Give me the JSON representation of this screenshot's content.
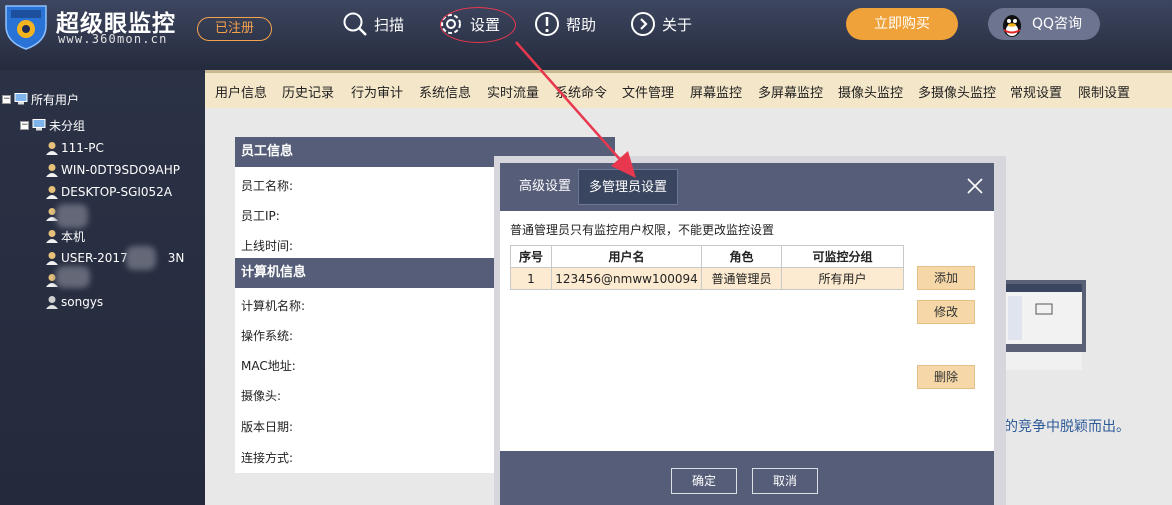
{
  "app": {
    "title": "超级眼监控",
    "url": "www.360mon.cn",
    "registered_label": "已注册"
  },
  "nav": {
    "scan": "扫描",
    "settings": "设置",
    "help": "帮助",
    "about": "关于"
  },
  "top_buttons": {
    "buy": "立即购买",
    "qq": "QQ咨询"
  },
  "tree": {
    "root": "所有用户",
    "group": "未分组",
    "computers": [
      "111-PC",
      "WIN-0DT9SDO9AHP",
      "DESKTOP-SGI052A",
      "",
      "本机",
      "USER-2017",
      "",
      "songys"
    ],
    "computer_suffix": "3N"
  },
  "tabs": [
    "用户信息",
    "历史记录",
    "行为审计",
    "系统信息",
    "实时流量",
    "系统命令",
    "文件管理",
    "屏幕监控",
    "多屏幕监控",
    "摄像头监控",
    "多摄像头监控",
    "常规设置",
    "限制设置"
  ],
  "info_panel": {
    "employee_header": "员工信息",
    "employee_fields": [
      "员工名称:",
      "员工IP:",
      "上线时间:"
    ],
    "computer_header": "计算机信息",
    "computer_fields": [
      "计算机名称:",
      "操作系统:",
      "MAC地址:",
      "摄像头:",
      "版本日期:",
      "连接方式:"
    ]
  },
  "ad_text": "烈的竞争中脱颖而出。",
  "dialog": {
    "tabs": {
      "advanced": "高级设置",
      "multi_admin": "多管理员设置"
    },
    "note": "普通管理员只有监控用户权限，不能更改监控设置",
    "table": {
      "headers": [
        "序号",
        "用户名",
        "角色",
        "可监控分组"
      ],
      "rows": [
        [
          "1",
          "123456@nmww100094",
          "普通管理员",
          "所有用户"
        ]
      ]
    },
    "buttons": {
      "add": "添加",
      "edit": "修改",
      "delete": "删除",
      "ok": "确定",
      "cancel": "取消"
    }
  },
  "colors": {
    "topbar": "#2f3650",
    "tabstrip": "#f4e6c8",
    "panel_header": "#555d78",
    "accent_orange": "#f0a23a",
    "annotation_red": "#e8384f"
  }
}
